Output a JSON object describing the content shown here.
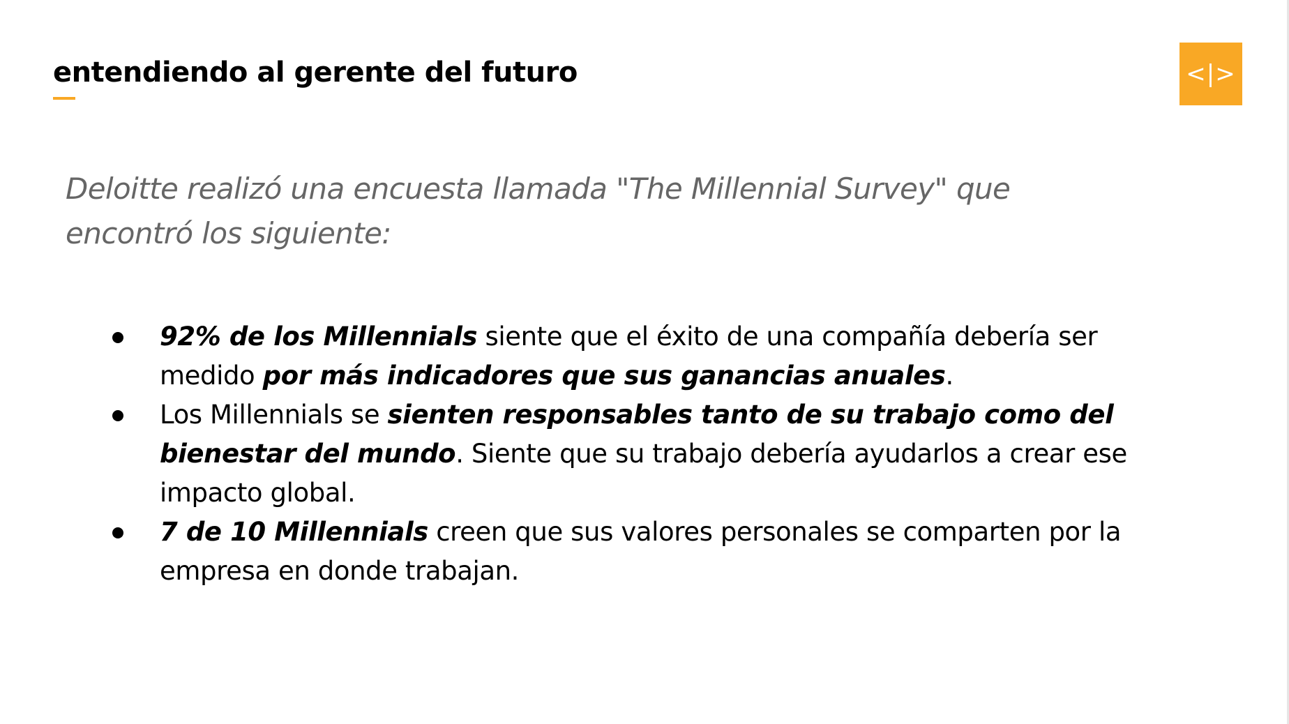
{
  "header": {
    "title": "entendiendo al gerente del futuro",
    "logo_text": "<|>",
    "accent_color": "#f9a825"
  },
  "intro": {
    "text": "Deloitte realizó una encuesta llamada \"The Millennial Survey\" que encontró los siguiente:"
  },
  "bullets": [
    {
      "b1": "92% de los Millennials",
      "t1": " siente que el éxito de una compañía debería ser medido ",
      "b2": "por más indicadores que sus ganancias anuales",
      "t2": "."
    },
    {
      "t1": "Los Millennials se ",
      "b1": "sienten responsables tanto de su trabajo como del bienestar del mundo",
      "t2": ". Siente que su trabajo debería ayudarlos a crear ese impacto global."
    },
    {
      "b1": "7 de 10 Millennials",
      "t1": " creen que sus valores personales se comparten por la empresa en donde trabajan."
    }
  ]
}
